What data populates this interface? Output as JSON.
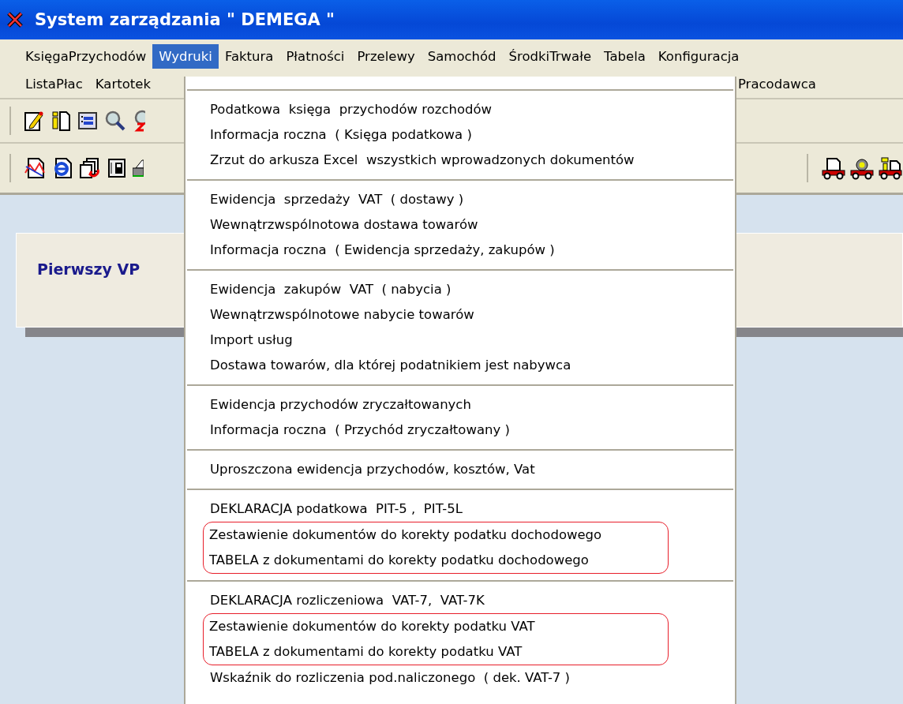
{
  "window": {
    "title": "System zarządzania \" DEMEGA \""
  },
  "menu_bar": {
    "row_1": [
      {
        "label": "KsięgaPrzychodów",
        "selected": false
      },
      {
        "label": "Wydruki",
        "selected": true
      },
      {
        "label": "Faktura",
        "selected": false
      },
      {
        "label": "Płatności",
        "selected": false
      },
      {
        "label": "Przelewy",
        "selected": false
      },
      {
        "label": "Samochód",
        "selected": false
      },
      {
        "label": "ŚrodkiTrwałe",
        "selected": false
      },
      {
        "label": "Tabela",
        "selected": false
      },
      {
        "label": "Konfiguracja",
        "selected": false
      }
    ],
    "row_2": [
      {
        "label": "ListaPłac",
        "selected": false
      },
      {
        "label": "Kartotek",
        "selected": false
      },
      {
        "label": "Pracodawca",
        "selected": false
      }
    ]
  },
  "panel": {
    "title": "Pierwszy VP"
  },
  "dropdown": {
    "groups": [
      {
        "items": [
          {
            "label": "Podatkowa  księga  przychodów rozchodów",
            "marked": false
          },
          {
            "label": "Informacja roczna  ( Księga podatkowa )",
            "marked": false
          },
          {
            "label": "Zrzut do arkusza Excel  wszystkich wprowadzonych dokumentów",
            "marked": false
          }
        ]
      },
      {
        "items": [
          {
            "label": "Ewidencja  sprzedaży  VAT  ( dostawy )",
            "marked": false
          },
          {
            "label": "Wewnątrzwspólnotowa dostawa towarów",
            "marked": false
          },
          {
            "label": "Informacja roczna  ( Ewidencja sprzedaży, zakupów )",
            "marked": false
          }
        ]
      },
      {
        "items": [
          {
            "label": "Ewidencja  zakupów  VAT  ( nabycia )",
            "marked": false
          },
          {
            "label": "Wewnątrzwspólnotowe nabycie towarów",
            "marked": false
          },
          {
            "label": "Import usług",
            "marked": false
          },
          {
            "label": "Dostawa towarów, dla której podatnikiem jest nabywca",
            "marked": false
          }
        ]
      },
      {
        "items": [
          {
            "label": "Ewidencja przychodów zryczałtowanych",
            "marked": false
          },
          {
            "label": "Informacja roczna  ( Przychód zryczałtowany )",
            "marked": false
          }
        ]
      },
      {
        "items": [
          {
            "label": "Uproszczona ewidencja przychodów, kosztów, Vat",
            "marked": false
          }
        ]
      },
      {
        "items": [
          {
            "label": "DEKLARACJA podatkowa  PIT-5 ,  PIT-5L",
            "marked": false
          },
          {
            "label": "Zestawienie dokumentów do korekty podatku dochodowego",
            "marked": true
          },
          {
            "label": "TABELA z dokumentami do korekty podatku dochodowego",
            "marked": true
          }
        ]
      },
      {
        "items": [
          {
            "label": "DEKLARACJA rozliczeniowa  VAT-7,  VAT-7K",
            "marked": false
          },
          {
            "label": "Zestawienie dokumentów do korekty podatku VAT",
            "marked": true
          },
          {
            "label": "TABELA z dokumentami do korekty podatku VAT",
            "marked": true
          },
          {
            "label": "Wskaźnik do rozliczenia pod.naliczonego  ( dek. VAT-7 )",
            "marked": false
          }
        ]
      }
    ]
  }
}
